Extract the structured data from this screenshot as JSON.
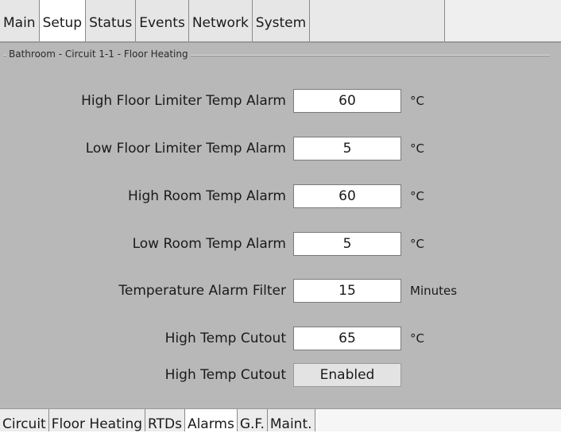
{
  "top_tabs": [
    {
      "label": "Main",
      "active": false
    },
    {
      "label": "Setup",
      "active": true
    },
    {
      "label": "Status",
      "active": false
    },
    {
      "label": "Events",
      "active": false
    },
    {
      "label": "Network",
      "active": false
    },
    {
      "label": "System",
      "active": false
    }
  ],
  "group": {
    "caption": "Bathroom - Circuit 1-1 - Floor Heating"
  },
  "rows": [
    {
      "label": "High Floor Limiter Temp Alarm",
      "value": "60",
      "unit": "°C",
      "kind": "input"
    },
    {
      "label": "Low Floor Limiter Temp Alarm",
      "value": "5",
      "unit": "°C",
      "kind": "input"
    },
    {
      "label": "High Room Temp Alarm",
      "value": "60",
      "unit": "°C",
      "kind": "input"
    },
    {
      "label": "Low Room Temp Alarm",
      "value": "5",
      "unit": "°C",
      "kind": "input"
    },
    {
      "label": "Temperature Alarm Filter",
      "value": "15",
      "unit": "Minutes",
      "kind": "input"
    },
    {
      "label": "High Temp Cutout",
      "value": "65",
      "unit": "°C",
      "kind": "input"
    },
    {
      "label": "High Temp Cutout",
      "value": "Enabled",
      "unit": "",
      "kind": "button"
    }
  ],
  "bottom_tabs": [
    {
      "label": "Circuit",
      "active": false
    },
    {
      "label": "Floor Heating",
      "active": false
    },
    {
      "label": "RTDs",
      "active": false
    },
    {
      "label": "Alarms",
      "active": true
    },
    {
      "label": "G.F.",
      "active": false
    },
    {
      "label": "Maint.",
      "active": false
    }
  ],
  "colors": {
    "panel": "#b8b8b8",
    "active_tab": "#ffffff",
    "inactive_tab": "#e6e6e6"
  }
}
